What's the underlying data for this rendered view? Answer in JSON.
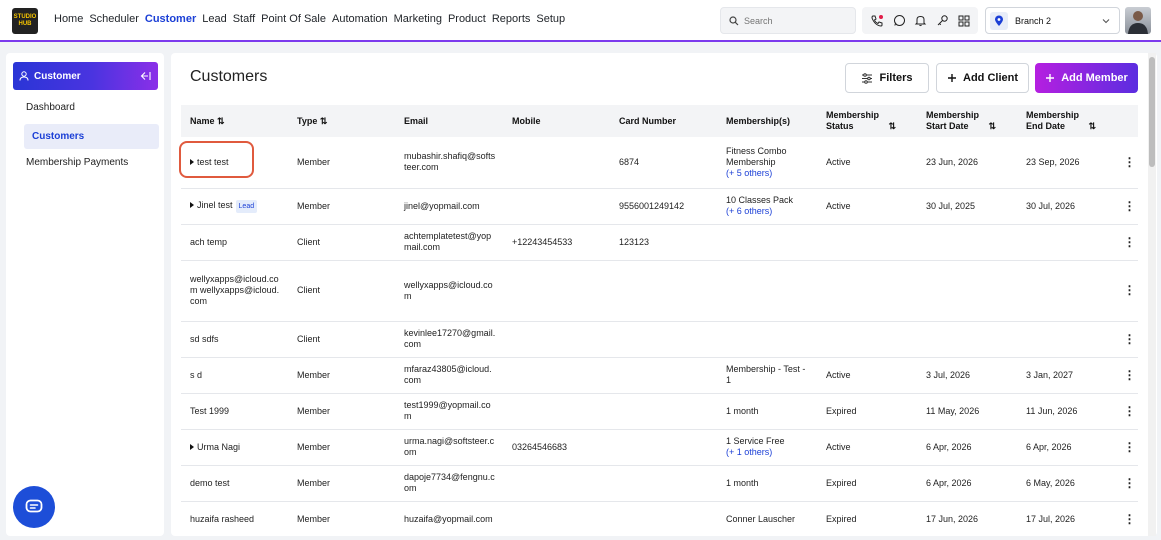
{
  "brand": {
    "logo_text": "STUDIO HUB",
    "accent": "#1b3fd6",
    "gradient_start": "#2a35d6",
    "gradient_end": "#8b2fe8"
  },
  "nav": [
    "Home",
    "Scheduler",
    "Customer",
    "Lead",
    "Staff",
    "Point Of Sale",
    "Automation",
    "Marketing",
    "Product",
    "Reports",
    "Setup"
  ],
  "search": {
    "placeholder": "Search"
  },
  "branch": {
    "label": "Branch 2"
  },
  "sidebar": {
    "header": "Customer",
    "items": [
      {
        "label": "Dashboard"
      },
      {
        "label": "Customers"
      },
      {
        "label": "Membership Payments"
      }
    ]
  },
  "main": {
    "title": "Customers",
    "filters_label": "Filters",
    "add_client_label": "Add Client",
    "add_member_label": "Add Member"
  },
  "table": {
    "columns": [
      "Name",
      "Type",
      "Email",
      "Mobile",
      "Card Number",
      "Membership(s)",
      "Membership Status",
      "Membership Start Date",
      "Membership End Date"
    ],
    "rows": [
      {
        "name": "test test",
        "expand": true,
        "badge": "",
        "type": "Member",
        "email": "mubashir.shafiq@softsteer.com",
        "mobile": "",
        "card": "6874",
        "membership": "Fitness Combo Membership",
        "others": "(+ 5 others)",
        "status": "Active",
        "start": "23 Jun, 2026",
        "end": "23 Sep, 2026"
      },
      {
        "name": "Jinel test",
        "expand": true,
        "badge": "Lead",
        "type": "Member",
        "email": "jinel@yopmail.com",
        "mobile": "",
        "card": "9556001249142",
        "membership": "10 Classes Pack",
        "others": "(+ 6 others)",
        "status": "Active",
        "start": "30 Jul, 2025",
        "end": "30 Jul, 2026"
      },
      {
        "name": "ach temp",
        "expand": false,
        "badge": "",
        "type": "Client",
        "email": "achtemplatetest@yopmail.com",
        "mobile": "+12243454533",
        "card": "123123",
        "membership": "",
        "others": "",
        "status": "",
        "start": "",
        "end": ""
      },
      {
        "name": "wellyxapps@icloud.com wellyxapps@icloud.com",
        "expand": false,
        "badge": "",
        "type": "Client",
        "email": "wellyxapps@icloud.com",
        "mobile": "",
        "card": "",
        "membership": "",
        "others": "",
        "status": "",
        "start": "",
        "end": ""
      },
      {
        "name": "sd sdfs",
        "expand": false,
        "badge": "",
        "type": "Client",
        "email": "kevinlee17270@gmail.com",
        "mobile": "",
        "card": "",
        "membership": "",
        "others": "",
        "status": "",
        "start": "",
        "end": ""
      },
      {
        "name": "s d",
        "expand": false,
        "badge": "",
        "type": "Member",
        "email": "mfaraz43805@icloud.com",
        "mobile": "",
        "card": "",
        "membership": "Membership - Test - 1",
        "others": "",
        "status": "Active",
        "start": "3 Jul, 2026",
        "end": "3 Jan, 2027"
      },
      {
        "name": "Test 1999",
        "expand": false,
        "badge": "",
        "type": "Member",
        "email": "test1999@yopmail.com",
        "mobile": "",
        "card": "",
        "membership": "1 month",
        "others": "",
        "status": "Expired",
        "start": "11 May, 2026",
        "end": "11 Jun, 2026"
      },
      {
        "name": "Urma Nagi",
        "expand": true,
        "badge": "",
        "type": "Member",
        "email": "urma.nagi@softsteer.com",
        "mobile": "03264546683",
        "card": "",
        "membership": "1 Service Free",
        "others": "(+ 1 others)",
        "status": "Active",
        "start": "6 Apr, 2026",
        "end": "6 Apr, 2026"
      },
      {
        "name": "demo test",
        "expand": false,
        "badge": "",
        "type": "Member",
        "email": "dapoje7734@fengnu.com",
        "mobile": "",
        "card": "",
        "membership": "1 month",
        "others": "",
        "status": "Expired",
        "start": "6 Apr, 2026",
        "end": "6 May, 2026"
      },
      {
        "name": "huzaifa rasheed",
        "expand": false,
        "badge": "",
        "type": "Member",
        "email": "huzaifa@yopmail.com",
        "mobile": "",
        "card": "",
        "membership": "Conner Lauscher",
        "others": "",
        "status": "Expired",
        "start": "17 Jun, 2026",
        "end": "17 Jul, 2026"
      }
    ]
  }
}
